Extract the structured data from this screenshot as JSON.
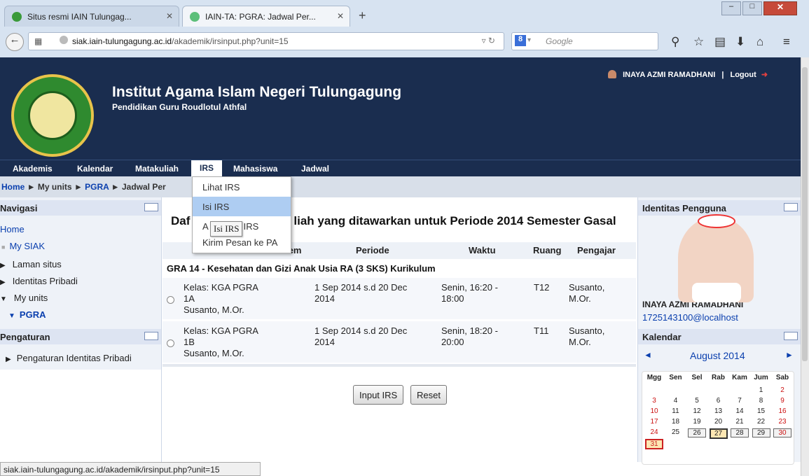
{
  "browser": {
    "tabs": [
      {
        "label": "Situs resmi IAIN Tulungag..."
      },
      {
        "label": "IAIN-TA: PGRA: Jadwal Per..."
      }
    ],
    "url_domain": "siak.iain-tulungagung.ac.id",
    "url_path": "/akademik/irsinput.php?unit=15",
    "search_placeholder": "Google"
  },
  "header": {
    "institution": "Institut Agama Islam Negeri Tulungagung",
    "subtitle": "Pendidikan Guru Roudlotul Athfal",
    "user": "INAYA AZMI RAMADHANI",
    "separator": "|",
    "logout": "Logout"
  },
  "menu": [
    "Akademis",
    "Kalendar",
    "Matakuliah",
    "IRS",
    "Mahasiswa",
    "Jadwal"
  ],
  "breadcrumb": {
    "home": "Home",
    "sep": "►",
    "units": "My units",
    "pgra": "PGRA",
    "current": "Jadwal Per"
  },
  "dropdown": [
    "Lihat IRS",
    "Isi IRS",
    "Ambil IRS",
    "Kirim Pesan ke PA"
  ],
  "dropdown_partial": {
    "left": "A",
    "right": "IRS"
  },
  "tooltip": "Isi IRS",
  "navigasi": {
    "title": "Navigasi",
    "items": [
      "Home",
      "My SIAK",
      "Laman situs",
      "Identitas Pribadi",
      "My units",
      "PGRA"
    ]
  },
  "pengaturan": {
    "title": "Pengaturan",
    "item": "Pengaturan Identitas Pribadi"
  },
  "main": {
    "title_left": "Daf",
    "title_right": "liah yang ditawarkan untuk Periode 2014 Semester Gasal",
    "columns": [
      "iem",
      "Periode",
      "Waktu",
      "Ruang",
      "Pengajar"
    ],
    "course": "GRA 14 - Kesehatan dan Gizi Anak Usia RA (3 SKS) Kurikulum",
    "rows": [
      {
        "kelas1": "Kelas: KGA PGRA",
        "kelas2": "1A",
        "kelas3": "Susanto, M.Or.",
        "periode1": "1 Sep 2014 s.d 20 Dec",
        "periode2": "2014",
        "waktu1": "Senin, 16:20 -",
        "waktu2": "18:00",
        "ruang": "T12",
        "pengajar1": "Susanto,",
        "pengajar2": "M.Or."
      },
      {
        "kelas1": "Kelas: KGA PGRA",
        "kelas2": "1B",
        "kelas3": "Susanto, M.Or.",
        "periode1": "1 Sep 2014 s.d 20 Dec",
        "periode2": "2014",
        "waktu1": "Senin, 18:20 -",
        "waktu2": "20:00",
        "ruang": "T11",
        "pengajar1": "Susanto,",
        "pengajar2": "M.Or."
      }
    ],
    "buttons": {
      "input": "Input IRS",
      "reset": "Reset"
    }
  },
  "identitas": {
    "title": "Identitas Pengguna",
    "name": "INAYA AZMI RAMADHANI",
    "email": "1725143100@localhost"
  },
  "kalendar": {
    "title": "Kalendar",
    "month": "August 2014",
    "prev": "◄",
    "next": "►",
    "days": [
      "Mgg",
      "Sen",
      "Sel",
      "Rab",
      "Kam",
      "Jum",
      "Sab"
    ],
    "weeks": [
      [
        "",
        "",
        "",
        "",
        "",
        "1",
        "2"
      ],
      [
        "3",
        "4",
        "5",
        "6",
        "7",
        "8",
        "9"
      ],
      [
        "10",
        "11",
        "12",
        "13",
        "14",
        "15",
        "16"
      ],
      [
        "17",
        "18",
        "19",
        "20",
        "21",
        "22",
        "23"
      ],
      [
        "24",
        "25",
        "26",
        "27",
        "28",
        "29",
        "30"
      ],
      [
        "31",
        "",
        "",
        "",
        "",
        "",
        ""
      ]
    ]
  },
  "status": "siak.iain-tulungagung.ac.id/akademik/irsinput.php?unit=15"
}
